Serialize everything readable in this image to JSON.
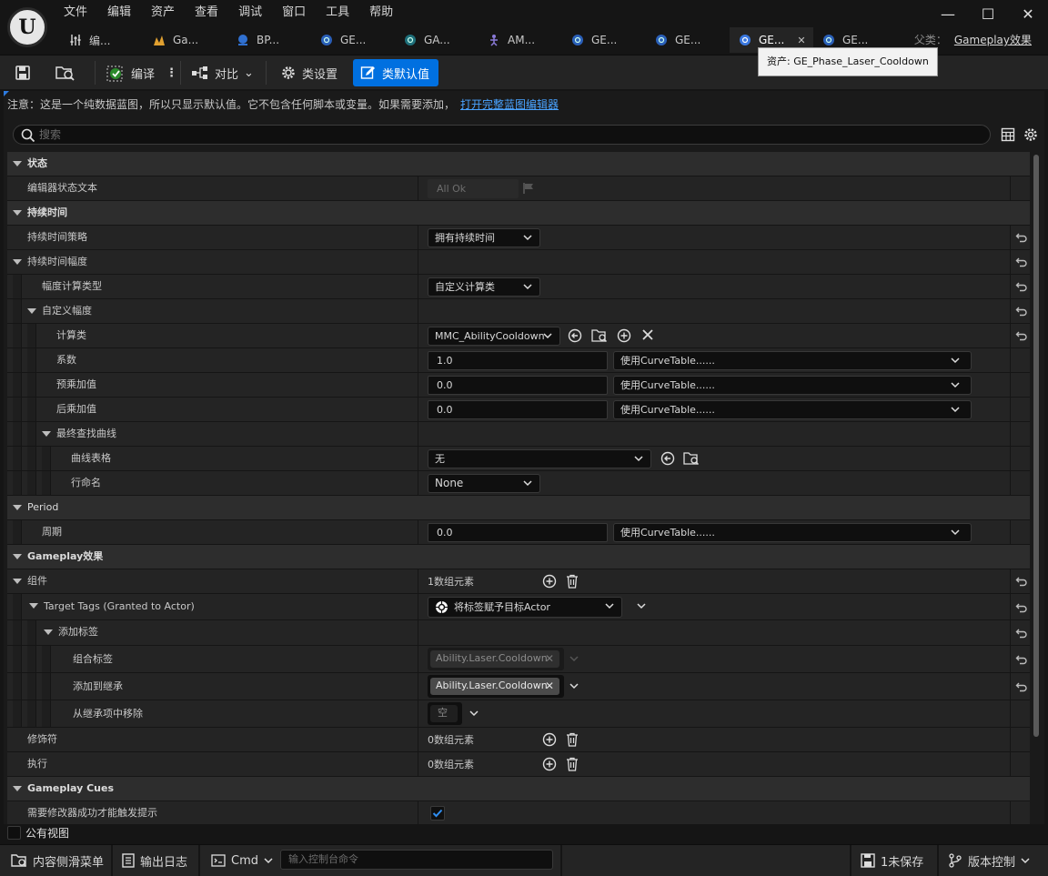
{
  "menu": [
    "文件",
    "编辑",
    "资产",
    "查看",
    "调试",
    "窗口",
    "工具",
    "帮助"
  ],
  "tabs": [
    {
      "label": "编...",
      "icon": "blueprint-icon"
    },
    {
      "label": "Ga...",
      "icon": "gameplay-icon"
    },
    {
      "label": "BP...",
      "icon": "character-icon"
    },
    {
      "label": "GE...",
      "icon": "gameplay-effect-icon"
    },
    {
      "label": "GA...",
      "icon": "gameplay-ability-icon"
    },
    {
      "label": "AM...",
      "icon": "animation-montage-icon"
    },
    {
      "label": "GE...",
      "icon": "gameplay-effect-icon"
    },
    {
      "label": "GE...",
      "icon": "gameplay-effect-icon"
    },
    {
      "label": "GE...",
      "icon": "gameplay-effect-icon",
      "active": true
    },
    {
      "label": "GE...",
      "icon": "gameplay-effect-icon"
    }
  ],
  "parent": {
    "label": "父类：",
    "value": "Gameplay效果"
  },
  "tooltip": "资产: GE_Phase_Laser_Cooldown",
  "toolbar": {
    "compile": "编译",
    "diff": "对比",
    "class_settings": "类设置",
    "class_defaults": "类默认值"
  },
  "notice": {
    "text": "注意：这是一个纯数据蓝图，所以只显示默认值。它不包含任何脚本或变量。如果需要添加，",
    "link": "打开完整蓝图编辑器"
  },
  "search": {
    "placeholder": "搜索"
  },
  "properties": {
    "status_cat": "状态",
    "editor_status_text": "编辑器状态文本",
    "editor_status_value": "All Ok",
    "duration_cat": "持续时间",
    "duration_policy": "持续时间策略",
    "duration_policy_value": "拥有持续时间",
    "duration_magnitude": "持续时间幅度",
    "magnitude_calc_type": "幅度计算类型",
    "magnitude_calc_type_value": "自定义计算类",
    "custom_magnitude": "自定义幅度",
    "calc_class": "计算类",
    "calc_class_value": "MMC_AbilityCooldown",
    "coefficient": "系数",
    "coefficient_value": "1.0",
    "pre_multiply": "预乘加值",
    "pre_multiply_value": "0.0",
    "post_multiply": "后乘加值",
    "post_multiply_value": "0.0",
    "curve_table_use": "使用CurveTable......",
    "final_lookup_curve": "最终查找曲线",
    "curve_table": "曲线表格",
    "curve_table_value": "无",
    "row_name": "行命名",
    "row_name_value": "None",
    "period_cat": "Period",
    "period": "周期",
    "period_value": "0.0",
    "gameplay_effect_cat": "Gameplay效果",
    "components": "组件",
    "components_value": "1数组元素",
    "target_tags": "Target Tags (Granted to Actor)",
    "target_tags_value": "将标签赋予目标Actor",
    "add_tags": "添加标签",
    "combined_tags": "组合标签",
    "combined_tags_value": "Ability.Laser.Cooldown",
    "added_to_inherited": "添加到继承",
    "added_to_inherited_value": "Ability.Laser.Cooldown",
    "removed_from_inherited": "从继承项中移除",
    "removed_from_inherited_value": "空",
    "modifiers": "修饰符",
    "modifiers_value": "0数组元素",
    "executions": "执行",
    "executions_value": "0数组元素",
    "gameplay_cues_cat": "Gameplay Cues",
    "require_modifier_success": "需要修改器成功才能触发提示",
    "require_modifier_success_checked": true
  },
  "public_view": "公有视图",
  "statusbar": {
    "content_drawer": "内容侧滑菜单",
    "output_log": "输出日志",
    "cmd": "Cmd",
    "console_placeholder": "输入控制台命令",
    "unsaved": "1未保存",
    "source_control": "版本控制"
  },
  "colors": {
    "accent": "#0070e0",
    "link": "#4aa3ff",
    "checkbox": "#0070e0"
  }
}
